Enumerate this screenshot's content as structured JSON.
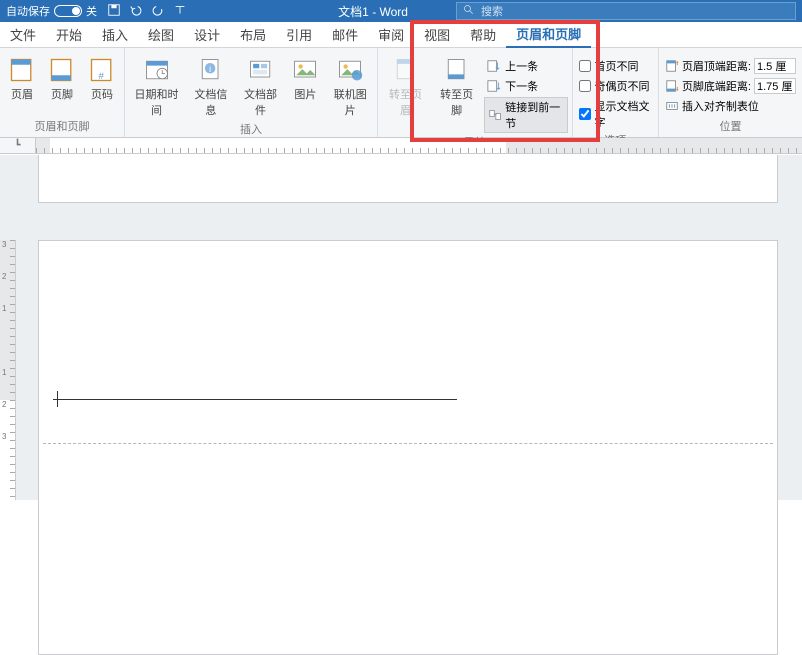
{
  "titlebar": {
    "autosave_label": "自动保存",
    "autosave_state": "关",
    "doc_title": "文档1 - Word",
    "search_placeholder": "搜索"
  },
  "tabs": {
    "file": "文件",
    "home": "开始",
    "insert": "插入",
    "draw": "绘图",
    "design": "设计",
    "layout": "布局",
    "references": "引用",
    "mailings": "邮件",
    "review": "审阅",
    "view": "视图",
    "help": "帮助",
    "header_footer": "页眉和页脚"
  },
  "ribbon": {
    "hf_group": {
      "header": "页眉",
      "footer": "页脚",
      "page_number": "页码",
      "label": "页眉和页脚"
    },
    "insert_group": {
      "datetime": "日期和时间",
      "docinfo": "文档信息",
      "docparts": "文档部件",
      "picture": "图片",
      "online_pic": "联机图片",
      "label": "插入"
    },
    "nav_group": {
      "goto_header": "转至页眉",
      "goto_footer": "转至页脚",
      "prev": "上一条",
      "next": "下一条",
      "link_prev": "链接到前一节",
      "label": "导航"
    },
    "options_group": {
      "first_diff": "首页不同",
      "oddeven_diff": "奇偶页不同",
      "show_doctext": "显示文档文字",
      "label": "选项"
    },
    "position_group": {
      "header_top": "页眉顶端距离:",
      "header_top_val": "1.5 厘",
      "footer_bottom": "页脚底端距离:",
      "footer_bottom_val": "1.75 厘",
      "align_tab": "插入对齐制表位",
      "label": "位置"
    }
  },
  "ruler_corner": "┗"
}
